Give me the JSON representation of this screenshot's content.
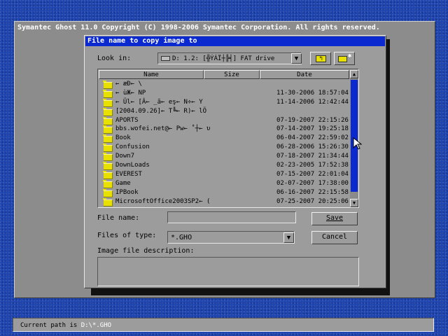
{
  "main": {
    "title": "Symantec Ghost 11.0    Copyright (C) 1998-2006 Symantec Corporation. All rights reserved."
  },
  "dialog": {
    "title": "File name to copy image to",
    "look_in_label": "Look in:",
    "look_in_value": "D: 1.2: [╬ÝÁÏ┼╠╡] FAT drive",
    "columns": [
      "Name",
      "Size",
      "Date"
    ],
    "files": [
      {
        "name": "← æÐ← \\",
        "date": ""
      },
      {
        "name": "← ùЖ← NP",
        "date": "11-30-2006 18:57:04"
      },
      {
        "name": "← Ül← [Â← _ã← eş← N÷← Y",
        "date": "11-14-2006 12:42:44"
      },
      {
        "name": "[2004.09.26]← T╚← R)← lÖ",
        "date": ""
      },
      {
        "name": "APORTS",
        "date": "07-19-2007 22:15:26"
      },
      {
        "name": "bbs.wofei.net@← Pw← ˚┼← υ",
        "date": "07-14-2007 19:25:18"
      },
      {
        "name": "Book",
        "date": "06-04-2007 22:59:02"
      },
      {
        "name": "Confusion",
        "date": "06-28-2006 15:26:30"
      },
      {
        "name": "Down7",
        "date": "07-18-2007 21:34:44"
      },
      {
        "name": "DownLoads",
        "date": "02-23-2005 17:52:38"
      },
      {
        "name": "EVEREST",
        "date": "07-15-2007 22:01:04"
      },
      {
        "name": "Game",
        "date": "02-07-2007 17:38:00"
      },
      {
        "name": "IPBook",
        "date": "06-16-2007 22:15:58"
      },
      {
        "name": "MicrosoftOffice2003SP2← (",
        "date": "07-25-2007 20:25:06"
      }
    ],
    "file_name_label": "File name:",
    "file_name_value": "",
    "files_of_type_label": "Files of type:",
    "files_of_type_value": "*.GHO",
    "description_label": "Image file description:",
    "save_label": "Save",
    "cancel_label": "Cancel"
  },
  "status": {
    "prefix": "Current path is",
    "path": "D:\\*.GHO"
  },
  "colors": {
    "desktop": "#1f45b0",
    "titlebar": "#0a2ad0",
    "window": "#9c9c9c",
    "folder": "#e8e000"
  },
  "icons": {
    "drive": "drive-icon",
    "up": "up-folder-icon",
    "new": "new-folder-icon",
    "folder": "folder-icon"
  }
}
